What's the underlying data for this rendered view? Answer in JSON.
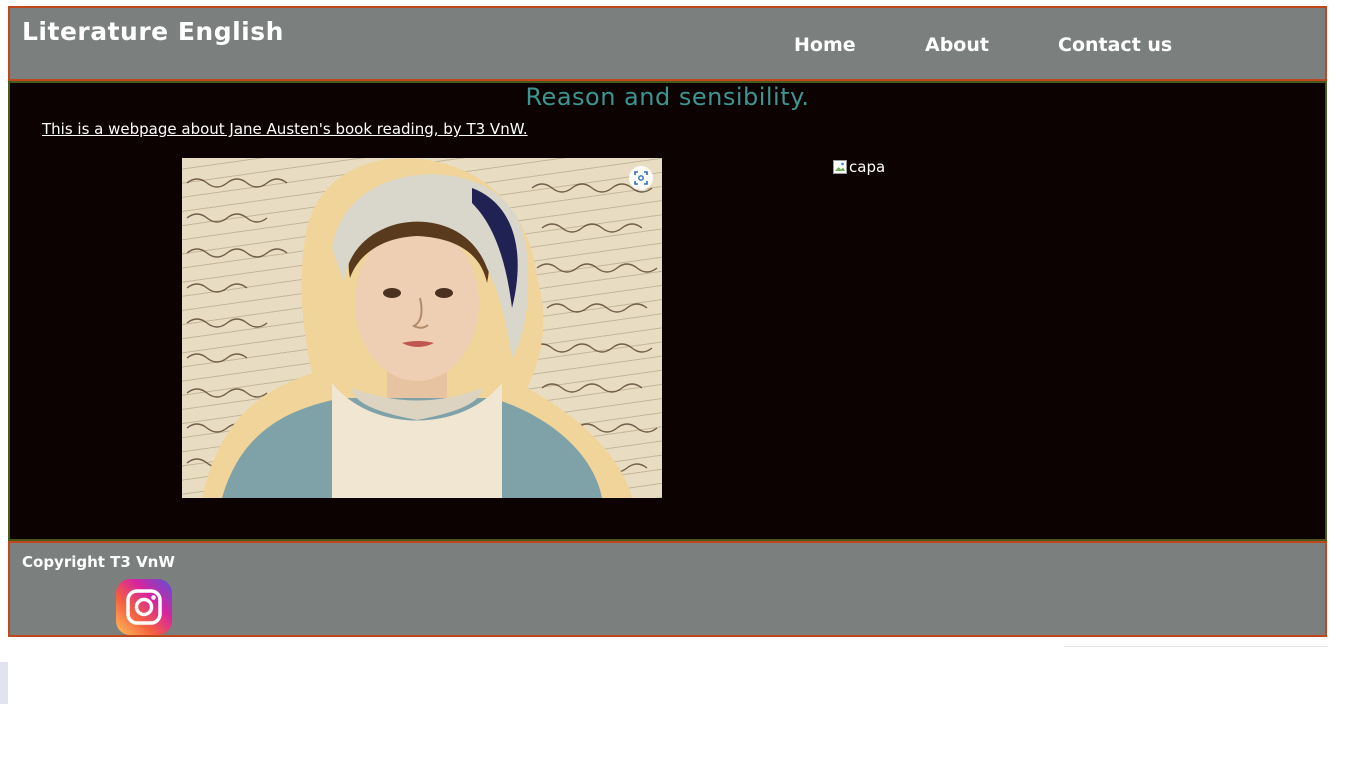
{
  "header": {
    "title": "Literature English",
    "nav": [
      {
        "label": "Home"
      },
      {
        "label": "About"
      },
      {
        "label": "Contact us"
      }
    ]
  },
  "main": {
    "heading": "Reason and sensibility.",
    "intro_link": "This is a webpage about Jane Austen's book reading, by T3 VnW.",
    "cover_image_alt": "capa",
    "portrait_icon": "scan-icon",
    "broken_image_icon": "broken-image-icon"
  },
  "footer": {
    "copyright": "Copyright T3 VnW",
    "social_icon": "instagram-icon"
  },
  "colors": {
    "header_bg": "#7b7f7e",
    "header_border": "#c0471b",
    "main_bg": "#0c0202",
    "main_border": "#475a1c",
    "heading": "#3d9490",
    "text": "#ffffff"
  }
}
